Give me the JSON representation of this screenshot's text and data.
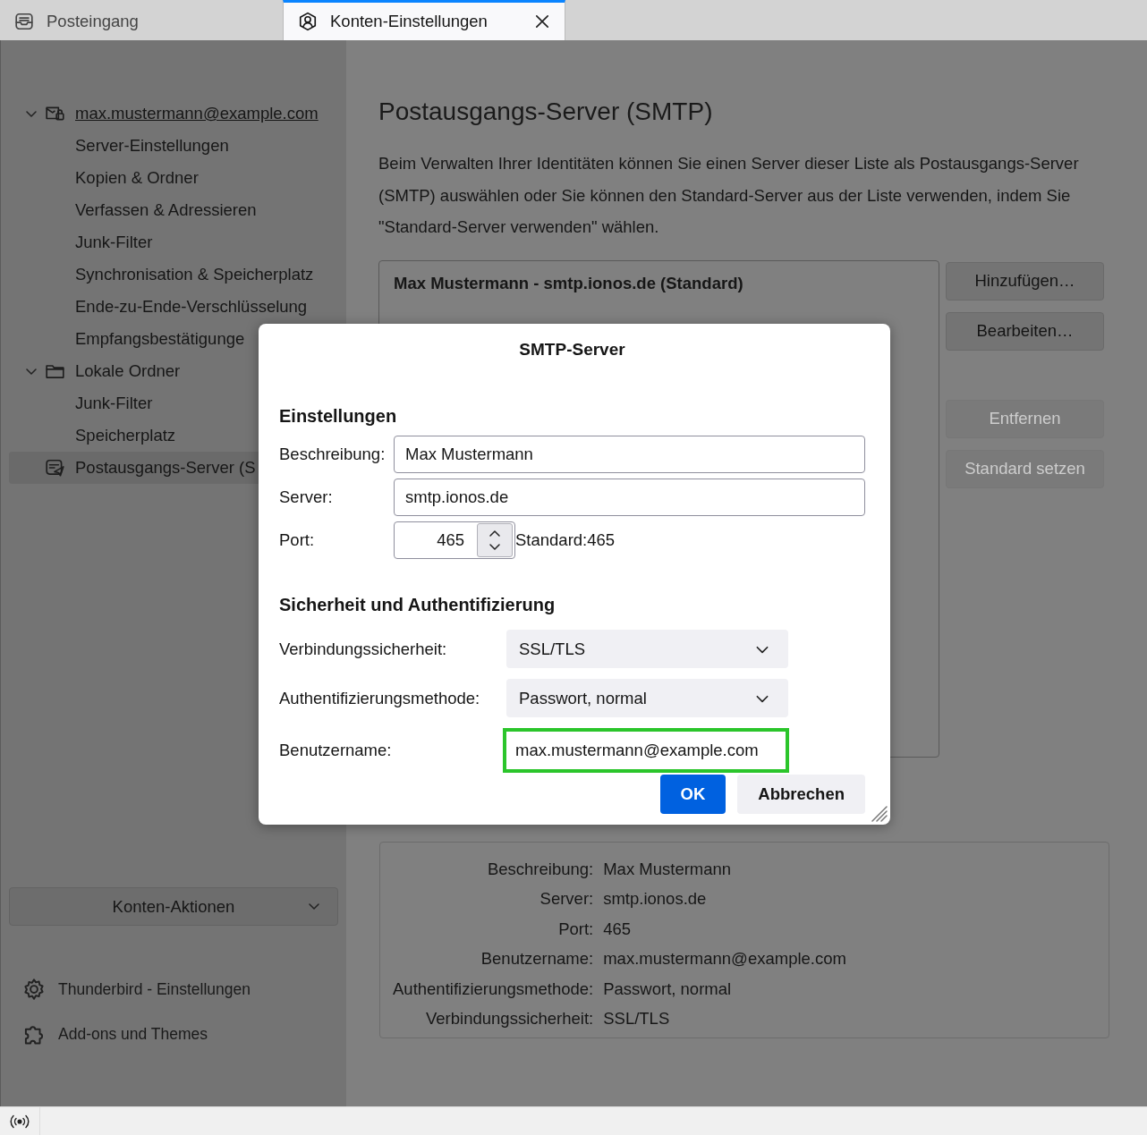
{
  "tabs": [
    {
      "label": "Posteingang",
      "kind": "inbox",
      "selected": false,
      "closable": false
    },
    {
      "label": "Konten-Einstellungen",
      "kind": "account",
      "selected": true,
      "closable": true
    }
  ],
  "sidebar": {
    "tree": [
      {
        "label": "max.mustermann@example.com",
        "kind": "account",
        "expanded": true,
        "selected": false,
        "children": [
          {
            "label": "Server-Einstellungen",
            "selected": false
          },
          {
            "label": "Kopien & Ordner",
            "selected": false
          },
          {
            "label": "Verfassen & Adressieren",
            "selected": false
          },
          {
            "label": "Junk-Filter",
            "selected": false
          },
          {
            "label": "Synchronisation & Speicherplatz",
            "selected": false
          },
          {
            "label": "Ende-zu-Ende-Verschlüsselung",
            "selected": false
          },
          {
            "label": "Empfangsbestätigunge",
            "selected": false
          }
        ]
      },
      {
        "label": "Lokale Ordner",
        "kind": "folder",
        "expanded": true,
        "selected": false,
        "children": [
          {
            "label": "Junk-Filter",
            "selected": false
          },
          {
            "label": "Speicherplatz",
            "selected": false
          }
        ]
      },
      {
        "label": "Postausgangs-Server (S",
        "kind": "outbox",
        "selected": true
      }
    ],
    "account_actions": {
      "label": "Konten-Aktionen"
    },
    "links": [
      {
        "label": "Thunderbird - Einstellungen",
        "kind": "settings"
      },
      {
        "label": "Add-ons und Themes",
        "kind": "addons"
      }
    ]
  },
  "main": {
    "title": "Postausgangs-Server (SMTP)",
    "description": "Beim Verwalten Ihrer Identitäten können Sie einen Server dieser Liste als Postausgangs-Server (SMTP) auswählen oder Sie können den Standard-Server aus der Liste verwenden, indem Sie \"Standard-Server verwenden\" wählen.",
    "servers": [
      {
        "label": "Max Mustermann - smtp.ionos.de (Standard)"
      }
    ],
    "buttons": [
      {
        "label": "Hinzufügen…",
        "disabled": false
      },
      {
        "label": "Bearbeiten…",
        "disabled": false
      },
      {
        "label": "Entfernen",
        "disabled": true
      },
      {
        "label": "Standard setzen",
        "disabled": true
      }
    ],
    "details": [
      {
        "label": "Beschreibung:",
        "value": "Max Mustermann"
      },
      {
        "label": "Server:",
        "value": "smtp.ionos.de"
      },
      {
        "label": "Port:",
        "value": "465"
      },
      {
        "label": "Benutzername:",
        "value": "max.mustermann@example.com"
      },
      {
        "label": "Authentifizierungsmethode:",
        "value": "Passwort, normal"
      },
      {
        "label": "Verbindungssicherheit:",
        "value": "SSL/TLS"
      }
    ]
  },
  "dialog": {
    "title": "SMTP-Server",
    "settings": {
      "heading": "Einstellungen",
      "description": {
        "label": "Beschreibung:",
        "value": "Max Mustermann"
      },
      "server": {
        "label": "Server:",
        "value": "smtp.ionos.de"
      },
      "port": {
        "label": "Port:",
        "value": "465",
        "default": "Standard:465"
      }
    },
    "security": {
      "heading": "Sicherheit und Authentifizierung",
      "fields": [
        {
          "kind": "select",
          "label": "Verbindungssicherheit:",
          "value": "SSL/TLS",
          "highlighted": false
        },
        {
          "kind": "select",
          "label": "Authentifizierungsmethode:",
          "value": "Passwort, normal",
          "highlighted": false
        },
        {
          "kind": "text",
          "label": "Benutzername:",
          "value": "max.mustermann@example.com",
          "highlighted": true
        }
      ]
    },
    "buttons": [
      {
        "label": "OK",
        "default": true
      },
      {
        "label": "Abbrechen",
        "default": false
      }
    ]
  }
}
